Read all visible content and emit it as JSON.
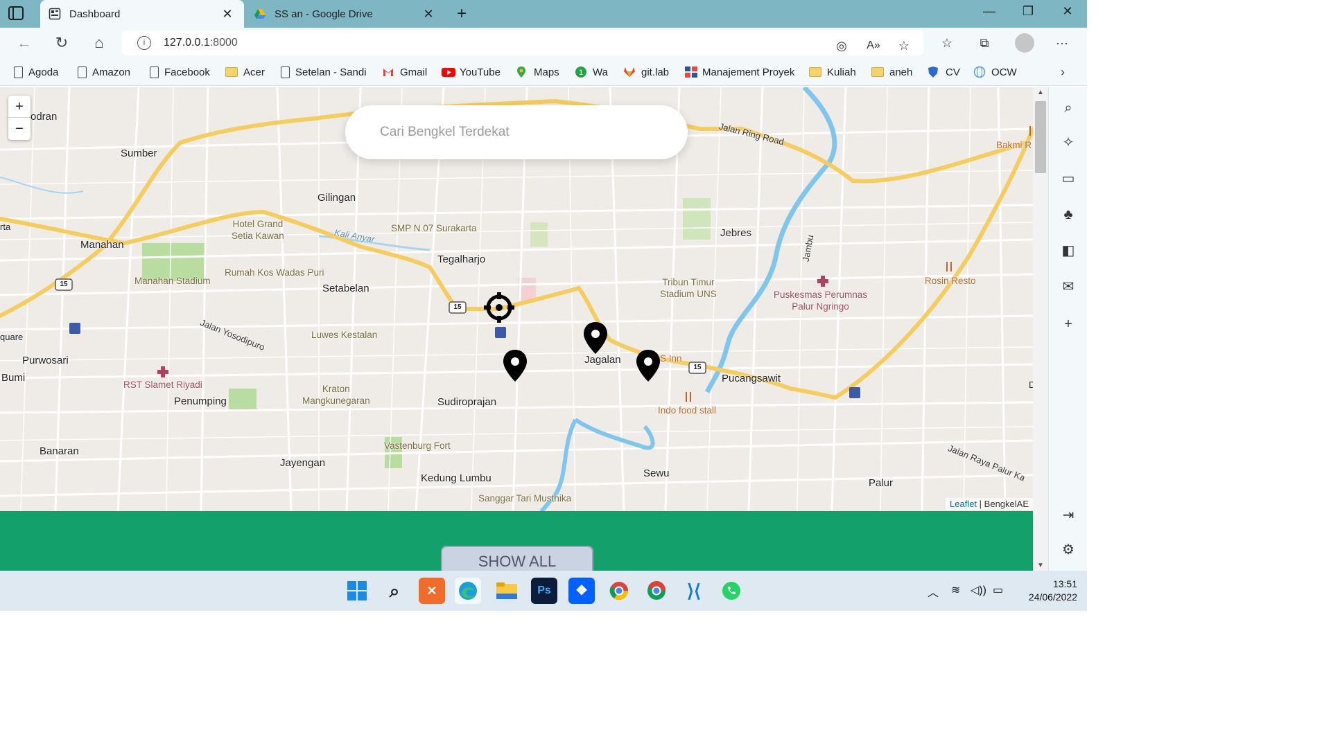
{
  "browser": {
    "tabs": [
      {
        "label": "Dashboard",
        "icon": "dashboard-tab-icon",
        "active": true
      },
      {
        "label": "SS an - Google Drive",
        "icon": "google-drive-icon",
        "active": false
      }
    ],
    "url_host": "127.0.0.1",
    "url_port": ":8000",
    "new_tab_glyph": "+",
    "window_controls": {
      "minimize": "—",
      "restore": "❐",
      "close": "✕"
    }
  },
  "bookmarks": [
    {
      "label": "Agoda",
      "icon": "page"
    },
    {
      "label": "Amazon",
      "icon": "page"
    },
    {
      "label": "Facebook",
      "icon": "page"
    },
    {
      "label": "Acer",
      "icon": "folder"
    },
    {
      "label": "Setelan - Sandi",
      "icon": "page"
    },
    {
      "label": "Gmail",
      "icon": "gmail"
    },
    {
      "label": "YouTube",
      "icon": "youtube"
    },
    {
      "label": "Maps",
      "icon": "maps"
    },
    {
      "label": "Wa",
      "icon": "whatsapp"
    },
    {
      "label": "git.lab",
      "icon": "gitlab"
    },
    {
      "label": "Manajement Proyek",
      "icon": "grid"
    },
    {
      "label": "Kuliah",
      "icon": "folder"
    },
    {
      "label": "aneh",
      "icon": "folder"
    },
    {
      "label": "CV",
      "icon": "shield"
    },
    {
      "label": "OCW",
      "icon": "globe"
    }
  ],
  "map": {
    "search_placeholder": "Cari Bengkel Terdekat",
    "zoom_in": "+",
    "zoom_out": "−",
    "attribution_link": "Leaflet",
    "attribution_sep": " | ",
    "attribution_text": "BengkelAE",
    "place_labels": [
      "odran",
      "Sumber",
      "Gilingan",
      "Manahan",
      "Tegalharjo",
      "Setabelan",
      "Jebres",
      "Jagalan",
      "Pucangsawit",
      "Purwosari",
      "Bumi",
      "Penumping",
      "Sudiroprajan",
      "Banaran",
      "Jayengan",
      "Kedung Lumbu",
      "Sewu",
      "Palur",
      "rta",
      "quare",
      "D"
    ],
    "poi_labels": [
      "Hotel Grand\nSetia Kawan",
      "SMP N 07 Surakarta",
      "Rumah Kos Wadas Puri",
      "Manahan Stadium",
      "Luwes Kestalan",
      "Kraton\nMangkunegaran",
      "Vastenburg Fort",
      "Tribun Timur\nStadium UNS",
      "Sanggar Tari Musthika"
    ],
    "poi_red_labels": [
      "RST Slamet Riyadi",
      "Puskesmas Perumnas\nPalur Ngringo"
    ],
    "poi_orange_labels": [
      "Rosin Resto",
      "Indo food stall",
      "Bakmi R",
      "S Inn"
    ],
    "road_labels": [
      "Jalan Ring Road",
      "Jalan Yosodipuro",
      "Kali Anyar",
      "Jambu",
      "Jalan Raya Palur Ka"
    ],
    "route_number": "15"
  },
  "footer": {
    "show_all_label": "SHOW ALL"
  },
  "taskbar": {
    "time": "13:51",
    "date": "24/06/2022"
  }
}
